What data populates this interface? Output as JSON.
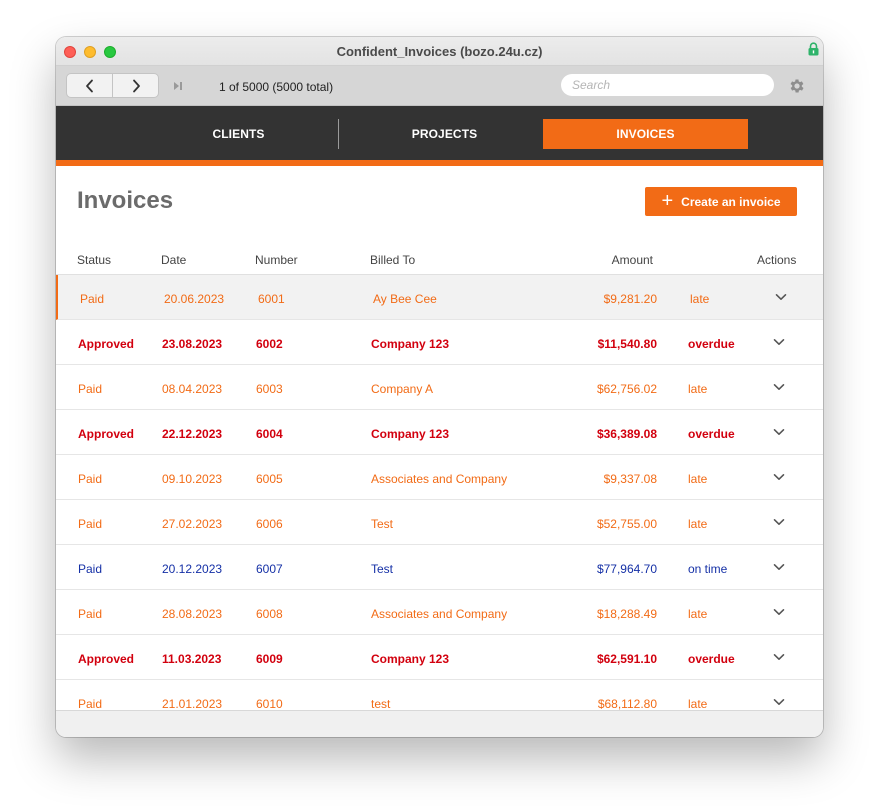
{
  "window": {
    "title": "Confident_Invoices (bozo.24u.cz)"
  },
  "toolbar": {
    "record_info": "1 of 5000  (5000 total)",
    "search_placeholder": "Search",
    "search_value": ""
  },
  "tabs": [
    {
      "label": "CLIENTS",
      "active": false
    },
    {
      "label": "PROJECTS",
      "active": false
    },
    {
      "label": "INVOICES",
      "active": true
    }
  ],
  "colors": {
    "accent": "#f26b16",
    "nav_bg": "#333333",
    "paid_late": "#f26b16",
    "approved_overdue": "#d2000e",
    "on_time": "#1530a6"
  },
  "page": {
    "title": "Invoices",
    "create_button_label": "Create an invoice",
    "create_button_icon": "plus-icon"
  },
  "table": {
    "columns": [
      "Status",
      "Date",
      "Number",
      "Billed To",
      "Amount",
      "",
      "Actions"
    ],
    "rows": [
      {
        "status": "Paid",
        "date": "20.06.2023",
        "number": "6001",
        "billed_to": "Ay Bee Cee",
        "amount": "$9,281.20",
        "timing": "late",
        "style": "paid",
        "selected": true
      },
      {
        "status": "Approved",
        "date": "23.08.2023",
        "number": "6002",
        "billed_to": "Company 123",
        "amount": "$11,540.80",
        "timing": "overdue",
        "style": "approved",
        "selected": false
      },
      {
        "status": "Paid",
        "date": "08.04.2023",
        "number": "6003",
        "billed_to": "Company A",
        "amount": "$62,756.02",
        "timing": "late",
        "style": "paid",
        "selected": false
      },
      {
        "status": "Approved",
        "date": "22.12.2023",
        "number": "6004",
        "billed_to": "Company 123",
        "amount": "$36,389.08",
        "timing": "overdue",
        "style": "approved",
        "selected": false
      },
      {
        "status": "Paid",
        "date": "09.10.2023",
        "number": "6005",
        "billed_to": "Associates and Company",
        "amount": "$9,337.08",
        "timing": "late",
        "style": "paid",
        "selected": false
      },
      {
        "status": "Paid",
        "date": "27.02.2023",
        "number": "6006",
        "billed_to": "Test",
        "amount": "$52,755.00",
        "timing": "late",
        "style": "paid",
        "selected": false
      },
      {
        "status": "Paid",
        "date": "20.12.2023",
        "number": "6007",
        "billed_to": "Test",
        "amount": "$77,964.70",
        "timing": "on time",
        "style": "ontime",
        "selected": false
      },
      {
        "status": "Paid",
        "date": "28.08.2023",
        "number": "6008",
        "billed_to": "Associates and Company",
        "amount": "$18,288.49",
        "timing": "late",
        "style": "paid",
        "selected": false
      },
      {
        "status": "Approved",
        "date": "11.03.2023",
        "number": "6009",
        "billed_to": "Company 123",
        "amount": "$62,591.10",
        "timing": "overdue",
        "style": "approved",
        "selected": false
      },
      {
        "status": "Paid",
        "date": "21.01.2023",
        "number": "6010",
        "billed_to": "test",
        "amount": "$68,112.80",
        "timing": "late",
        "style": "paid",
        "selected": false
      }
    ]
  }
}
